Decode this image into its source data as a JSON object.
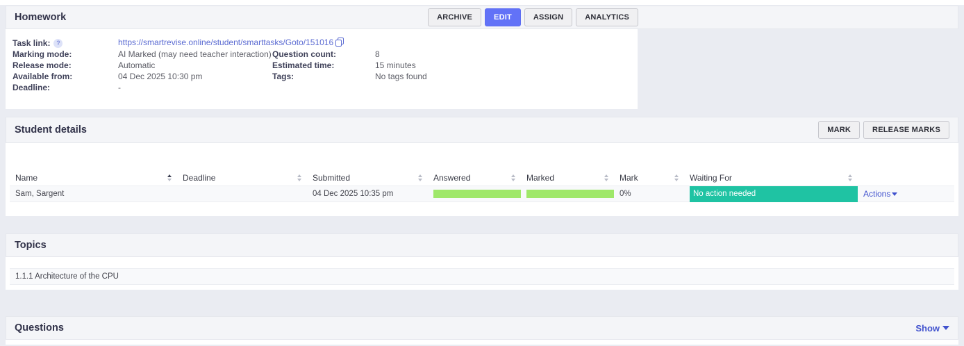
{
  "homework": {
    "title": "Homework",
    "buttons": {
      "archive": "ARCHIVE",
      "edit": "EDIT",
      "assign": "ASSIGN",
      "analytics": "ANALYTICS"
    },
    "details": {
      "task_link": {
        "label": "Task link:",
        "help_icon": "question-mark",
        "url": "https://smartrevise.online/student/smarttasks/Goto/151016",
        "copy_icon": "copy"
      },
      "fields_left": [
        {
          "label": "Marking mode:",
          "value": "AI Marked (may need teacher interaction)"
        },
        {
          "label": "Release mode:",
          "value": "Automatic"
        },
        {
          "label": "Available from:",
          "value": "04 Dec 2025 10:30 pm"
        },
        {
          "label": "Deadline:",
          "value": "-"
        }
      ],
      "fields_right": [
        {
          "label": "Question count:",
          "value": "8"
        },
        {
          "label": "Estimated time:",
          "value": "15 minutes"
        },
        {
          "label": "Tags:",
          "value": "No tags found"
        }
      ]
    }
  },
  "students": {
    "title": "Student details",
    "buttons": {
      "mark": "MARK",
      "release_marks": "RELEASE MARKS"
    },
    "table": {
      "columns": [
        "Name",
        "Deadline",
        "Submitted",
        "Answered",
        "Marked",
        "Mark",
        "Waiting For"
      ],
      "sorted_column": "Name",
      "sort_direction": "asc",
      "rows": [
        {
          "name": "Sam, Sargent",
          "deadline": "",
          "submitted": "04 Dec 2025 10:35 pm",
          "answered_pct": 100,
          "marked_pct": 100,
          "mark": "0%",
          "waiting_for": "No action needed",
          "actions_label": "Actions"
        }
      ]
    }
  },
  "topics": {
    "title": "Topics",
    "items": [
      "1.1.1 Architecture of the CPU"
    ]
  },
  "questions": {
    "title": "Questions",
    "show_label": "Show"
  },
  "colors": {
    "accent_blue": "#6272f7",
    "progress_green": "#9fe86a",
    "badge_teal": "#1fc3a3",
    "link_blue": "#5b6bd2",
    "page_background": "#eaecf2"
  }
}
